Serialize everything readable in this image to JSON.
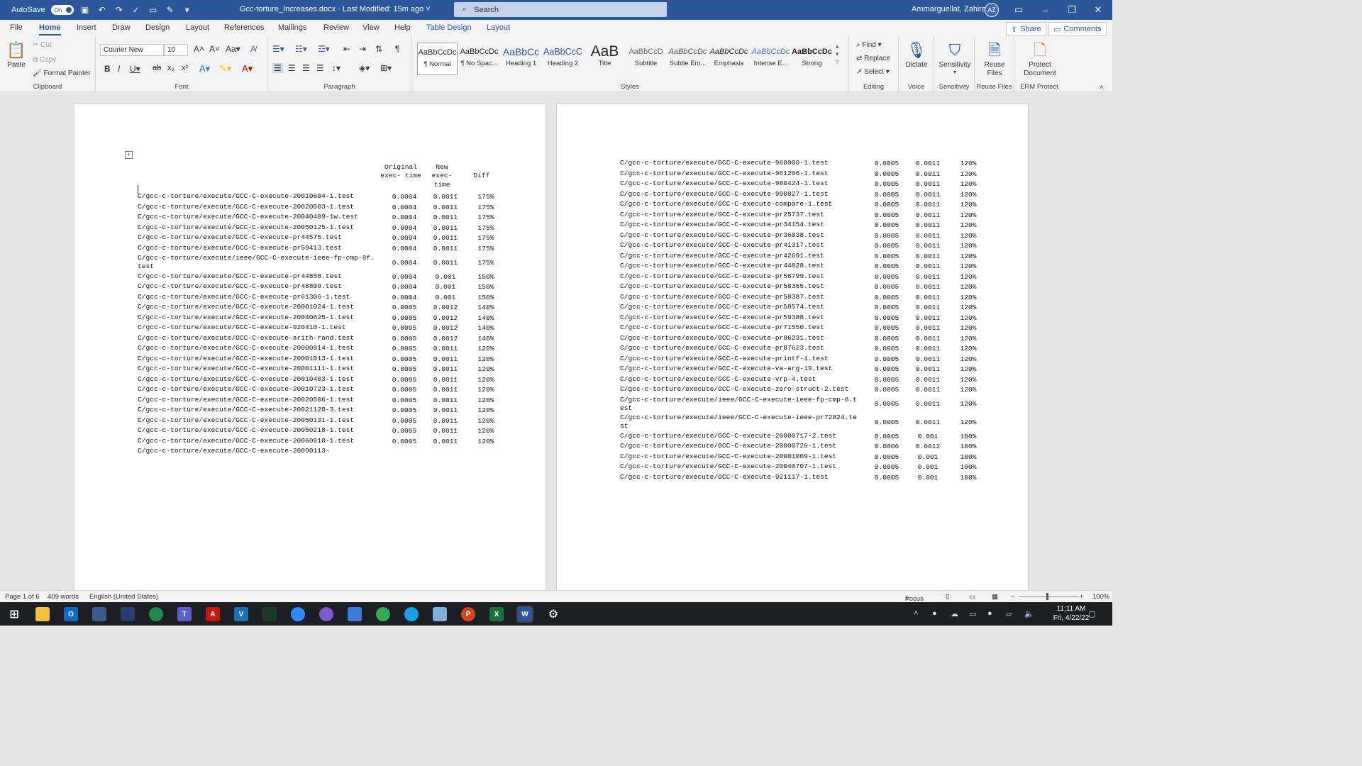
{
  "titlebar": {
    "autosave_label": "AutoSave",
    "autosave_state": "On",
    "doc_title": "Gcc-torture_Increases.docx  ·  Last Modified: 15m ago  ˅",
    "search_placeholder": "Search",
    "user_name": "Ammarguellat, Zahira",
    "user_initials": "AZ"
  },
  "menu": {
    "tabs": [
      "File",
      "Home",
      "Insert",
      "Draw",
      "Design",
      "Layout",
      "References",
      "Mailings",
      "Review",
      "View",
      "Help",
      "Table Design",
      "Layout"
    ],
    "share": "Share",
    "comments": "Comments"
  },
  "ribbon": {
    "clipboard": {
      "paste": "Paste",
      "cut": "Cut",
      "copy": "Copy",
      "format_painter": "Format Painter",
      "label": "Clipboard"
    },
    "font": {
      "name": "Courier New",
      "size": "10",
      "label": "Font"
    },
    "paragraph": {
      "label": "Paragraph"
    },
    "styles": {
      "label": "Styles",
      "tiles": [
        {
          "preview": "AaBbCcDc",
          "name": "¶ Normal"
        },
        {
          "preview": "AaBbCcDc",
          "name": "¶ No Spac..."
        },
        {
          "preview": "AaBbCc",
          "name": "Heading 1"
        },
        {
          "preview": "AaBbCcC",
          "name": "Heading 2"
        },
        {
          "preview": "AaB",
          "name": "Title"
        },
        {
          "preview": "AaBbCcD",
          "name": "Subtitle"
        },
        {
          "preview": "AaBbCcDc",
          "name": "Subtle Em..."
        },
        {
          "preview": "AaBbCcDc",
          "name": "Emphasis"
        },
        {
          "preview": "AaBbCcDc",
          "name": "Intense E..."
        },
        {
          "preview": "AaBbCcDc",
          "name": "Strong"
        }
      ]
    },
    "editing": {
      "find": "Find",
      "replace": "Replace",
      "select": "Select",
      "label": "Editing"
    },
    "voice": {
      "dictate": "Dictate",
      "label": "Voice"
    },
    "sensitivity": {
      "button": "Sensitivity",
      "label": "Sensitivity"
    },
    "reuse": {
      "button": "Reuse Files",
      "label": "Reuse Files"
    },
    "erm": {
      "button": "Protect Document",
      "label": "ERM Protect"
    }
  },
  "table_header": {
    "col1": "Original exec- time",
    "col2": "New exec- time",
    "col3": "Diff"
  },
  "left_rows": [
    {
      "path": "C/gcc-c-torture/execute/GCC-C-execute-20010604-1.test",
      "orig": "0.0004",
      "new": "0.0011",
      "diff": "175%"
    },
    {
      "path": "C/gcc-c-torture/execute/GCC-C-execute-20020503-1.test",
      "orig": "0.0004",
      "new": "0.0011",
      "diff": "175%"
    },
    {
      "path": "C/gcc-c-torture/execute/GCC-C-execute-20040409-1w.test",
      "orig": "0.0004",
      "new": "0.0011",
      "diff": "175%"
    },
    {
      "path": "C/gcc-c-torture/execute/GCC-C-execute-20050125-1.test",
      "orig": "0.0004",
      "new": "0.0011",
      "diff": "175%"
    },
    {
      "path": " C/gcc-c-torture/execute/GCC-C-execute-pr44575.test",
      "orig": "0.0004",
      "new": "0.0011",
      "diff": "175%"
    },
    {
      "path": " C/gcc-c-torture/execute/GCC-C-execute-pr59413.test",
      "orig": "0.0004",
      "new": "0.0011",
      "diff": "175%"
    },
    {
      "path": " C/gcc-c-torture/execute/ieee/GCC-C-execute-ieee-fp-cmp-8f.test",
      "orig": "0.0004",
      "new": "0.0011",
      "diff": "175%"
    },
    {
      "path": " C/gcc-c-torture/execute/GCC-C-execute-pr44858.test",
      "orig": "0.0004",
      "new": "0.001",
      "diff": "150%"
    },
    {
      "path": " C/gcc-c-torture/execute/GCC-C-execute-pr48809.test",
      "orig": "0.0004",
      "new": "0.001",
      "diff": "150%"
    },
    {
      "path": " C/gcc-c-torture/execute/GCC-C-execute-pr61306-1.test",
      "orig": "0.0004",
      "new": "0.001",
      "diff": "150%"
    },
    {
      "path": "C/gcc-c-torture/execute/GCC-C-execute-20001024-1.test",
      "orig": "0.0005",
      "new": "0.0012",
      "diff": "140%"
    },
    {
      "path": "C/gcc-c-torture/execute/GCC-C-execute-20040625-1.test",
      "orig": "0.0005",
      "new": "0.0012",
      "diff": "140%"
    },
    {
      "path": "C/gcc-c-torture/execute/GCC-C-execute-920410-1.test",
      "orig": "0.0005",
      "new": "0.0012",
      "diff": "140%"
    },
    {
      "path": " C/gcc-c-torture/execute/GCC-C-execute-arith-rand.test",
      "orig": "0.0005",
      "new": "0.0012",
      "diff": "140%"
    },
    {
      "path": "C/gcc-c-torture/execute/GCC-C-execute-20000914-1.test",
      "orig": "0.0005",
      "new": "0.0011",
      "diff": "120%"
    },
    {
      "path": "C/gcc-c-torture/execute/GCC-C-execute-20001013-1.test",
      "orig": "0.0005",
      "new": "0.0011",
      "diff": "120%"
    },
    {
      "path": "C/gcc-c-torture/execute/GCC-C-execute-20001111-1.test",
      "orig": "0.0005",
      "new": "0.0011",
      "diff": "120%"
    },
    {
      "path": "C/gcc-c-torture/execute/GCC-C-execute-20010403-1.test",
      "orig": "0.0005",
      "new": "0.0011",
      "diff": "120%"
    },
    {
      "path": "C/gcc-c-torture/execute/GCC-C-execute-20010723-1.test",
      "orig": "0.0005",
      "new": "0.0011",
      "diff": "120%"
    },
    {
      "path": "C/gcc-c-torture/execute/GCC-C-execute-20020506-1.test",
      "orig": "0.0005",
      "new": "0.0011",
      "diff": "120%"
    },
    {
      "path": "C/gcc-c-torture/execute/GCC-C-execute-20021120-3.test",
      "orig": "0.0005",
      "new": "0.0011",
      "diff": "120%"
    },
    {
      "path": "C/gcc-c-torture/execute/GCC-C-execute-20050131-1.test",
      "orig": "0.0005",
      "new": "0.0011",
      "diff": "120%"
    },
    {
      "path": "C/gcc-c-torture/execute/GCC-C-execute-20050218-1.test",
      "orig": "0.0005",
      "new": "0.0011",
      "diff": "120%"
    },
    {
      "path": "C/gcc-c-torture/execute/GCC-C-execute-20060910-1.test",
      "orig": "0.0005",
      "new": "0.0011",
      "diff": "120%"
    },
    {
      "path": "C/gcc-c-torture/execute/GCC-C-execute-20090113-",
      "orig": "",
      "new": "",
      "diff": ""
    }
  ],
  "right_rows": [
    {
      "path": " C/gcc-c-torture/execute/GCC-C-execute-960909-1.test",
      "orig": "0.0005",
      "new": "0.0011",
      "diff": "120%"
    },
    {
      "path": " C/gcc-c-torture/execute/GCC-C-execute-961206-1.test",
      "orig": "0.0005",
      "new": "0.0011",
      "diff": "120%"
    },
    {
      "path": " C/gcc-c-torture/execute/GCC-C-execute-980424-1.test",
      "orig": "0.0005",
      "new": "0.0011",
      "diff": "120%"
    },
    {
      "path": " C/gcc-c-torture/execute/GCC-C-execute-990827-1.test",
      "orig": "0.0005",
      "new": "0.0011",
      "diff": "120%"
    },
    {
      "path": " C/gcc-c-torture/execute/GCC-C-execute-compare-1.test",
      "orig": "0.0005",
      "new": "0.0011",
      "diff": "120%"
    },
    {
      "path": " C/gcc-c-torture/execute/GCC-C-execute-pr25737.test",
      "orig": "0.0005",
      "new": "0.0011",
      "diff": "120%"
    },
    {
      "path": " C/gcc-c-torture/execute/GCC-C-execute-pr34154.test",
      "orig": "0.0005",
      "new": "0.0011",
      "diff": "120%"
    },
    {
      "path": " C/gcc-c-torture/execute/GCC-C-execute-pr36038.test",
      "orig": "0.0005",
      "new": "0.0011",
      "diff": "120%"
    },
    {
      "path": " C/gcc-c-torture/execute/GCC-C-execute-pr41317.test",
      "orig": "0.0005",
      "new": "0.0011",
      "diff": "120%"
    },
    {
      "path": " C/gcc-c-torture/execute/GCC-C-execute-pr42691.test",
      "orig": "0.0005",
      "new": "0.0011",
      "diff": "120%"
    },
    {
      "path": " C/gcc-c-torture/execute/GCC-C-execute-pr44828.test",
      "orig": "0.0005",
      "new": "0.0011",
      "diff": "120%"
    },
    {
      "path": " C/gcc-c-torture/execute/GCC-C-execute-pr56799.test",
      "orig": "0.0005",
      "new": "0.0011",
      "diff": "120%"
    },
    {
      "path": " C/gcc-c-torture/execute/GCC-C-execute-pr58365.test",
      "orig": "0.0005",
      "new": "0.0011",
      "diff": "120%"
    },
    {
      "path": " C/gcc-c-torture/execute/GCC-C-execute-pr58387.test",
      "orig": "0.0005",
      "new": "0.0011",
      "diff": "120%"
    },
    {
      "path": " C/gcc-c-torture/execute/GCC-C-execute-pr58574.test",
      "orig": "0.0005",
      "new": "0.0011",
      "diff": "120%"
    },
    {
      "path": " C/gcc-c-torture/execute/GCC-C-execute-pr59388.test",
      "orig": "0.0005",
      "new": "0.0011",
      "diff": "120%"
    },
    {
      "path": " C/gcc-c-torture/execute/GCC-C-execute-pr71550.test",
      "orig": "0.0005",
      "new": "0.0011",
      "diff": "120%"
    },
    {
      "path": " C/gcc-c-torture/execute/GCC-C-execute-pr86231.test",
      "orig": "0.0005",
      "new": "0.0011",
      "diff": "120%"
    },
    {
      "path": " C/gcc-c-torture/execute/GCC-C-execute-pr87623.test",
      "orig": "0.0005",
      "new": "0.0011",
      "diff": "120%"
    },
    {
      "path": " C/gcc-c-torture/execute/GCC-C-execute-printf-1.test",
      "orig": "0.0005",
      "new": "0.0011",
      "diff": "120%"
    },
    {
      "path": " C/gcc-c-torture/execute/GCC-C-execute-va-arg-19.test",
      "orig": "0.0005",
      "new": "0.0011",
      "diff": "120%"
    },
    {
      "path": " C/gcc-c-torture/execute/GCC-C-execute-vrp-4.test",
      "orig": "0.0005",
      "new": "0.0011",
      "diff": "120%"
    },
    {
      "path": " C/gcc-c-torture/execute/GCC-C-execute-zero-struct-2.test",
      "orig": "0.0005",
      "new": "0.0011",
      "diff": "120%"
    },
    {
      "path": " C/gcc-c-torture/execute/ieee/GCC-C-execute-ieee-fp-cmp-6.test",
      "orig": "0.0005",
      "new": "0.0011",
      "diff": "120%"
    },
    {
      "path": " C/gcc-c-torture/execute/ieee/GCC-C-execute-ieee-pr72824.test",
      "orig": "0.0005",
      "new": "0.0011",
      "diff": "120%"
    },
    {
      "path": "C/gcc-c-torture/execute/GCC-C-execute-20000717-2.test",
      "orig": "0.0005",
      "new": "0.001",
      "diff": "100%"
    },
    {
      "path": "C/gcc-c-torture/execute/GCC-C-execute-20000726-1.test",
      "orig": "0.0006",
      "new": "0.0012",
      "diff": "100%"
    },
    {
      "path": "C/gcc-c-torture/execute/GCC-C-execute-20001009-1.test",
      "orig": "0.0005",
      "new": "0.001",
      "diff": "100%"
    },
    {
      "path": "C/gcc-c-torture/execute/GCC-C-execute-20040707-1.test",
      "orig": "0.0005",
      "new": "0.001",
      "diff": "100%"
    },
    {
      "path": "C/gcc-c-torture/execute/GCC-C-execute-921117-1.test",
      "orig": "0.0005",
      "new": "0.001",
      "diff": "100%"
    }
  ],
  "statusbar": {
    "page": "Page 1 of 6",
    "words": "409 words",
    "language": "English (United States)",
    "focus": "Focus",
    "zoom": "100%"
  },
  "clock": {
    "time": "11:11 AM",
    "date": "Fri, 4/22/22"
  }
}
